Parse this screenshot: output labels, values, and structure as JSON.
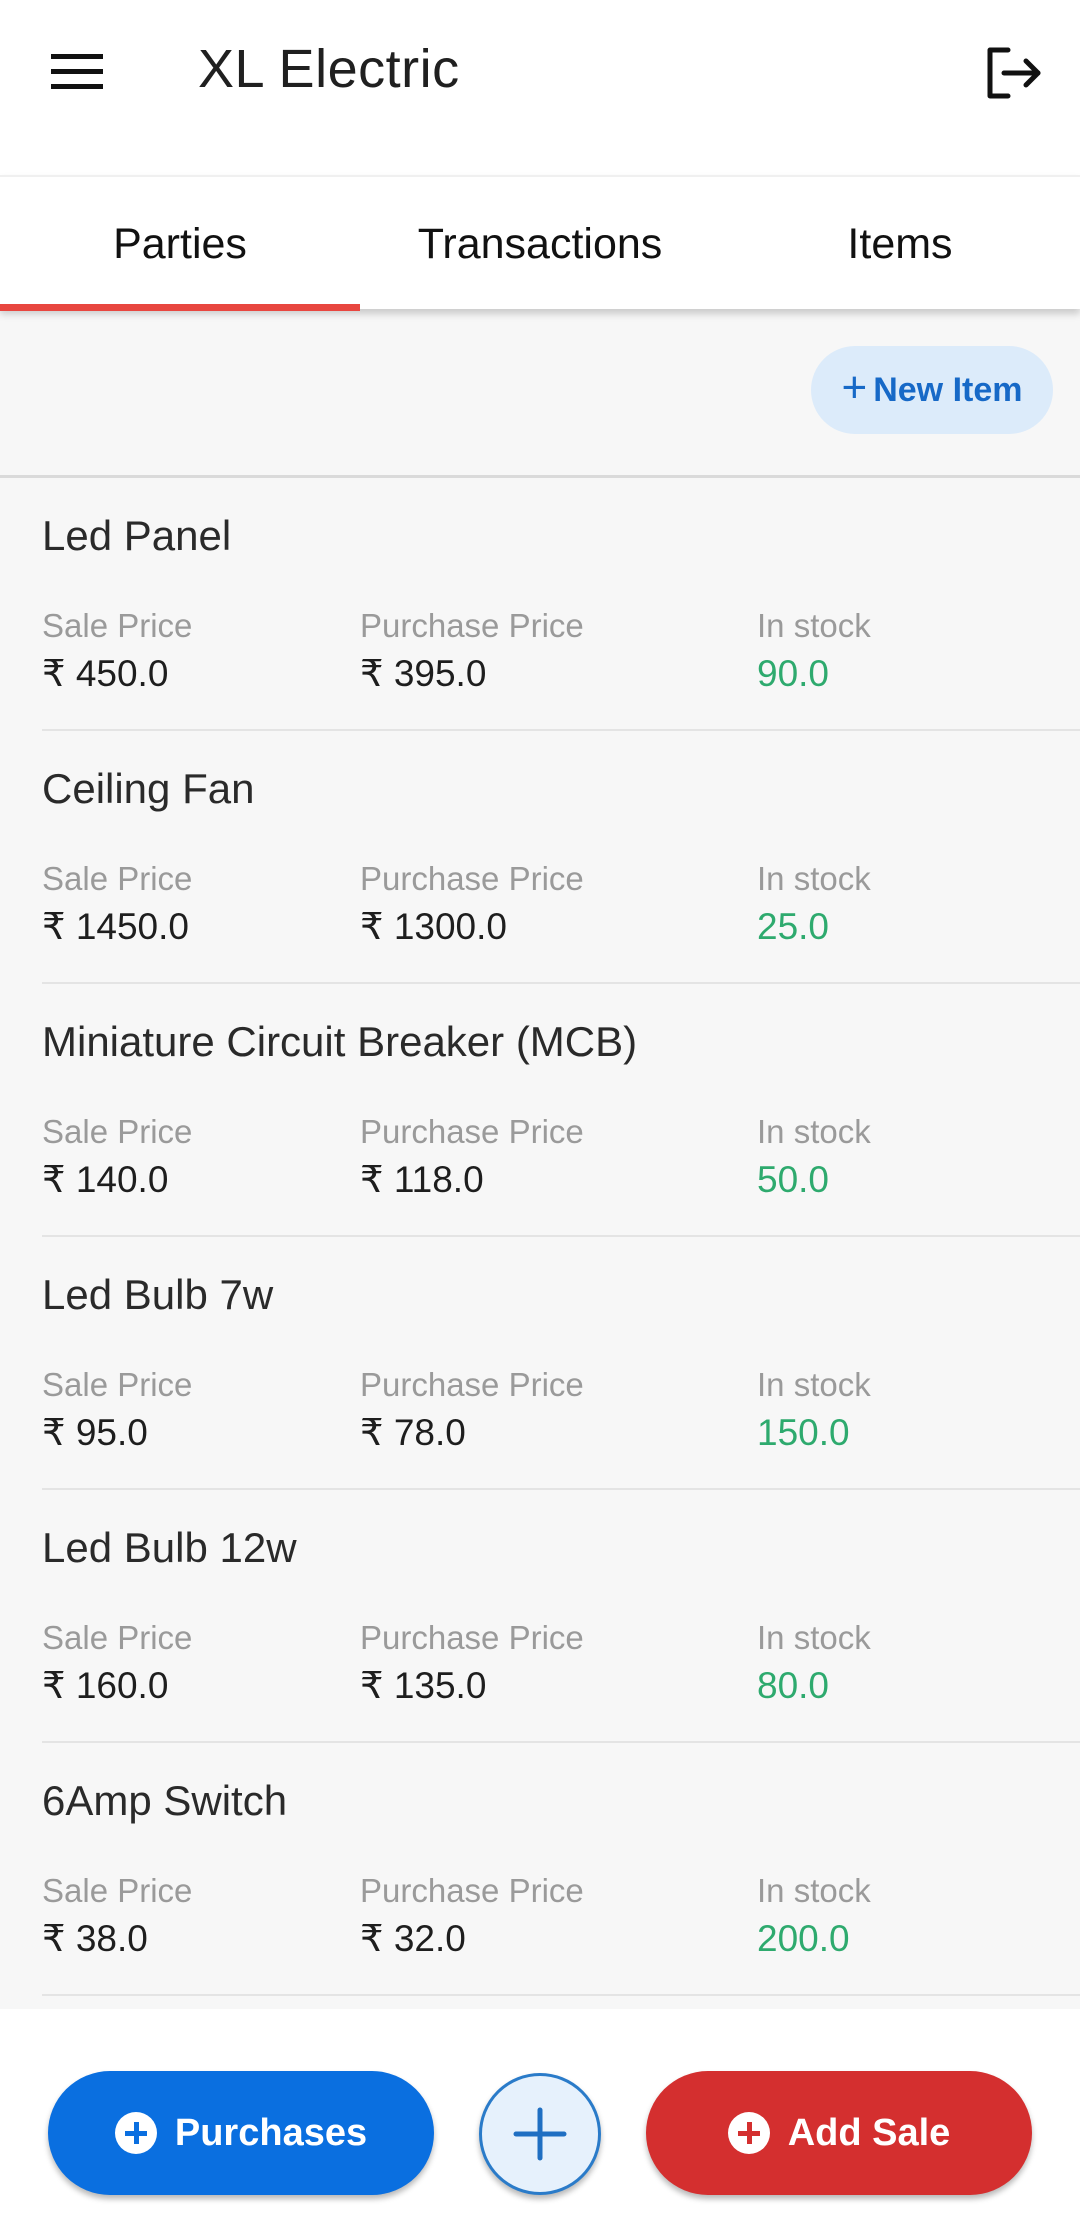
{
  "app": {
    "title": "XL Electric",
    "icons": {
      "menu": "menu-icon",
      "logout": "logout-icon"
    }
  },
  "tabs": [
    {
      "label": "Parties",
      "active": true
    },
    {
      "label": "Transactions",
      "active": false
    },
    {
      "label": "Items",
      "active": false
    }
  ],
  "toolbar": {
    "new_item_label": "New Item",
    "new_item_icon": "plus"
  },
  "labels": {
    "sale_price": "Sale Price",
    "purchase_price": "Purchase Price",
    "in_stock": "In stock"
  },
  "items": [
    {
      "name": "Led Panel",
      "sale_price": "₹ 450.0",
      "purchase_price": "₹ 395.0",
      "stock": "90.0"
    },
    {
      "name": "Ceiling Fan",
      "sale_price": "₹ 1450.0",
      "purchase_price": "₹ 1300.0",
      "stock": "25.0"
    },
    {
      "name": "Miniature Circuit Breaker (MCB)",
      "sale_price": "₹ 140.0",
      "purchase_price": "₹ 118.0",
      "stock": "50.0"
    },
    {
      "name": "Led Bulb 7w",
      "sale_price": "₹ 95.0",
      "purchase_price": "₹ 78.0",
      "stock": "150.0"
    },
    {
      "name": "Led Bulb 12w",
      "sale_price": "₹ 160.0",
      "purchase_price": "₹ 135.0",
      "stock": "80.0"
    },
    {
      "name": "6Amp Switch",
      "sale_price": "₹ 38.0",
      "purchase_price": "₹ 32.0",
      "stock": "200.0"
    }
  ],
  "bottom": {
    "purchases_label": "Purchases",
    "add_sale_label": "Add Sale"
  },
  "colors": {
    "accent_tab": "#e8463f",
    "purchases": "#0a6fe0",
    "add_sale": "#d42f2f",
    "stock_text": "#2eaa6e",
    "new_item_bg": "#dcebfa",
    "new_item_text": "#1769c7"
  }
}
